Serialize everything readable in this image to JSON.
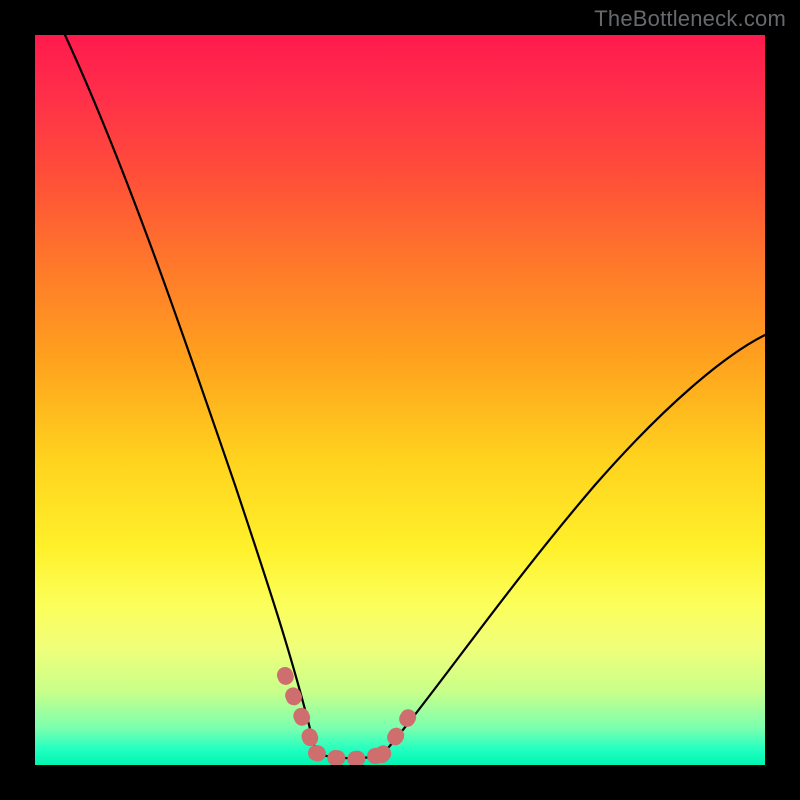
{
  "watermark": {
    "text": "TheBottleneck.com"
  },
  "colors": {
    "background": "#000000",
    "curve": "#000000",
    "marker": "#cf6e6e",
    "gradient_stops": [
      "#ff1a4d",
      "#ff5138",
      "#ffa01e",
      "#ffd21e",
      "#fcff5a",
      "#c8ff8a",
      "#1effc0",
      "#00f5b0"
    ]
  },
  "chart_data": {
    "type": "line",
    "title": "",
    "xlabel": "",
    "ylabel": "",
    "xlim": [
      0,
      100
    ],
    "ylim": [
      0,
      100
    ],
    "grid": false,
    "legend": false,
    "series": [
      {
        "name": "left-curve",
        "x": [
          4,
          10,
          16,
          22,
          26,
          30,
          33,
          35,
          37,
          38.5
        ],
        "y": [
          100,
          78,
          57,
          37,
          25,
          15,
          8,
          4,
          2,
          1
        ]
      },
      {
        "name": "valley-floor",
        "x": [
          38.5,
          40,
          42,
          44,
          46,
          47.5
        ],
        "y": [
          1,
          0.6,
          0.5,
          0.5,
          0.7,
          1
        ]
      },
      {
        "name": "right-curve",
        "x": [
          47.5,
          52,
          58,
          66,
          76,
          88,
          100
        ],
        "y": [
          1,
          5,
          12,
          22,
          34,
          47,
          58
        ]
      }
    ],
    "annotations": [
      {
        "name": "highlighted-valley-range",
        "note": "dotted coral markers along valley walls and floor",
        "x_range": [
          34,
          50
        ],
        "y_range": [
          0,
          10
        ]
      }
    ]
  }
}
